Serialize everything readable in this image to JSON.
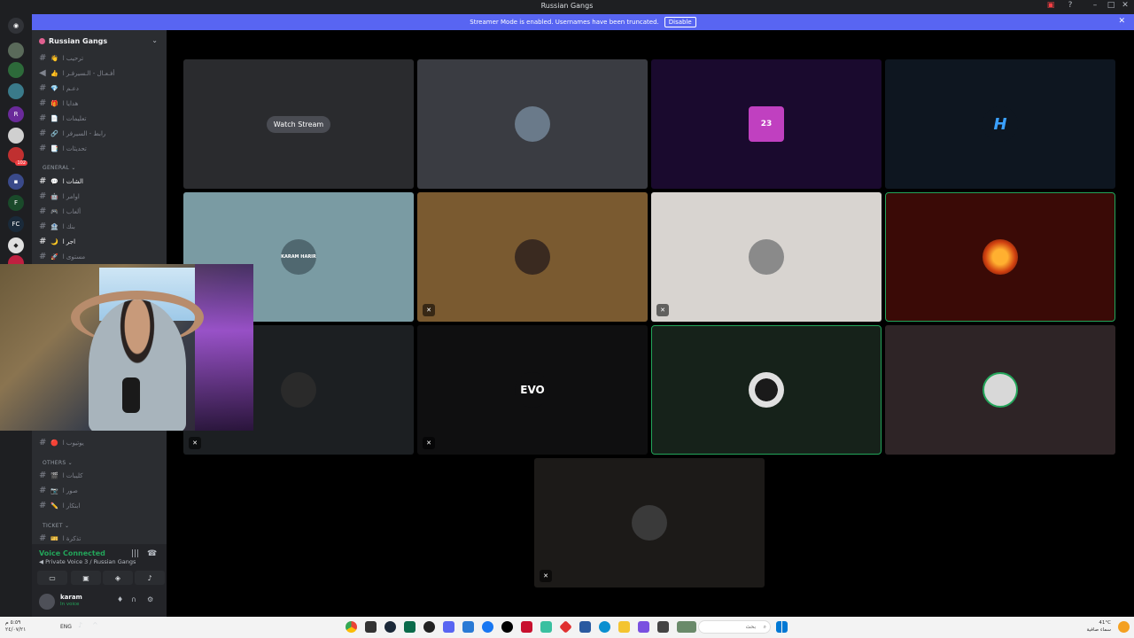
{
  "window": {
    "title": "Russian Gangs"
  },
  "banner": {
    "text": "Streamer Mode is enabled. Usernames have been truncated.",
    "disable_label": "Disable"
  },
  "rail": {
    "badges": [
      "102"
    ]
  },
  "sidebar": {
    "server_name": "Russian Gangs",
    "channels_top": [
      {
        "emoji": "👋",
        "label": "ترحيب ا"
      },
      {
        "emoji": "👍",
        "label": "أفـعـال - الـسيرفـر ا"
      },
      {
        "emoji": "💎",
        "label": "دعـم ا"
      },
      {
        "emoji": "🎁",
        "label": "هدايا ا"
      },
      {
        "emoji": "📄",
        "label": "تعليمات ا"
      },
      {
        "emoji": "🔗",
        "label": "رابط - السيرفر ا"
      },
      {
        "emoji": "📑",
        "label": "تحديثات ا"
      }
    ],
    "category_general": "GENERAL",
    "channels_general": [
      {
        "emoji": "💬",
        "label": "الشات ا",
        "active": true
      },
      {
        "emoji": "🤖",
        "label": "اوامر ا"
      },
      {
        "emoji": "🎮",
        "label": "ألعاب ا"
      },
      {
        "emoji": "🏦",
        "label": "بنك ا"
      },
      {
        "emoji": "🌙",
        "label": "اجر ا",
        "active": true
      },
      {
        "emoji": "🚀",
        "label": "مستوى ا"
      }
    ],
    "channel_youtube": {
      "emoji": "🔴",
      "label": "يوتيوب ا"
    },
    "category_others": "OTHERS",
    "channels_others": [
      {
        "emoji": "🎬",
        "label": "كليبات ا"
      },
      {
        "emoji": "📷",
        "label": "صور ا"
      },
      {
        "emoji": "✏️",
        "label": "ابتكار ا"
      }
    ],
    "category_ticket": "TICKET",
    "channels_ticket": [
      {
        "emoji": "🎫",
        "label": "تذكرة ا"
      }
    ]
  },
  "voice_panel": {
    "status": "Voice Connected",
    "channel": "Private Voice 3 / Russian Gangs",
    "username": "karam",
    "user_status": "In voice"
  },
  "tiles": [
    {
      "name": "stream-tile",
      "bg": "#2a2b2e",
      "watch_label": "Watch Stream"
    },
    {
      "name": "participant-2",
      "bg": "#3a3c42",
      "avatar_bg": "#6a7a8a"
    },
    {
      "name": "participant-3",
      "bg": "#1a0a2e",
      "avatar_bg": "#c040c0",
      "avatar_text": "23"
    },
    {
      "name": "participant-4",
      "bg": "#0e1620",
      "avatar_bg": "#0e1620",
      "avatar_text": "H"
    },
    {
      "name": "participant-5",
      "bg": "#7a9ba3",
      "avatar_bg": "#506870",
      "avatar_text": "KARAM HARIR",
      "muted": true
    },
    {
      "name": "participant-6",
      "bg": "#7a5a30",
      "avatar_bg": "#3a2a20",
      "muted": true
    },
    {
      "name": "participant-7",
      "bg": "#d8d4d0",
      "avatar_bg": "#8a8a8a",
      "muted": true
    },
    {
      "name": "participant-8",
      "bg": "#3a0a06",
      "avatar_bg": "#d06010",
      "speaking": true
    },
    {
      "name": "participant-9",
      "bg": "#1c1f22",
      "avatar_bg": "#2a2a2a",
      "muted": true
    },
    {
      "name": "participant-10",
      "bg": "#0f0f10",
      "avatar_bg": "#0f0f10",
      "avatar_text": "EVO",
      "muted": true
    },
    {
      "name": "participant-11",
      "bg": "#16221a",
      "avatar_bg": "#e0e0e0",
      "speaking": true
    },
    {
      "name": "participant-12",
      "bg": "#2e2426",
      "avatar_bg": "#d8d8d8"
    },
    {
      "name": "participant-13",
      "bg": "#1c1a18",
      "avatar_bg": "#3a3a3a",
      "muted": true
    }
  ],
  "taskbar": {
    "time": "٥:٥٩ م",
    "date": "٢٤/٠٧/٢١",
    "lang": "ENG",
    "search_placeholder": "بحث",
    "weather_temp": "41°C",
    "weather_desc": "سماء صافية"
  }
}
